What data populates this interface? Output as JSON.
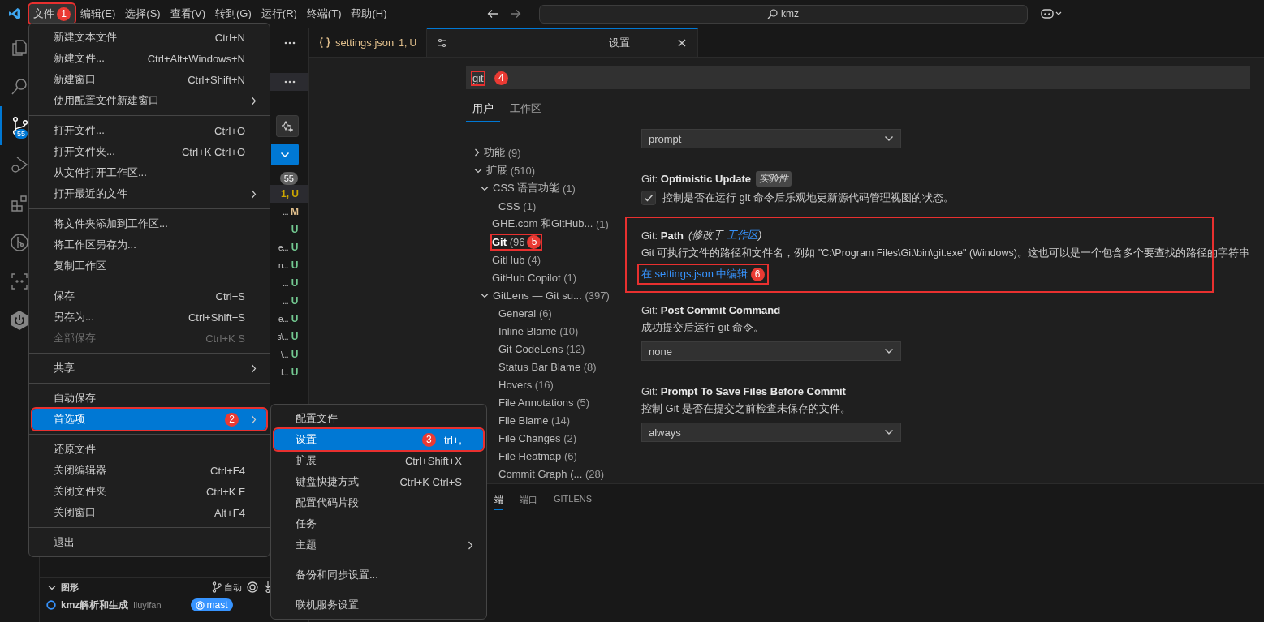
{
  "menubar": [
    {
      "label": "文件",
      "selected": true,
      "callout": "1"
    },
    {
      "label": "编辑(E)",
      "selected": false
    },
    {
      "label": "选择(S)",
      "selected": false
    },
    {
      "label": "查看(V)",
      "selected": false
    },
    {
      "label": "转到(G)",
      "selected": false
    },
    {
      "label": "运行(R)",
      "selected": false
    },
    {
      "label": "终端(T)",
      "selected": false
    },
    {
      "label": "帮助(H)",
      "selected": false
    }
  ],
  "command_center": {
    "value": "kmz"
  },
  "activity_bar": [
    {
      "kind": "files",
      "selected": false
    },
    {
      "kind": "search",
      "selected": false
    },
    {
      "kind": "scm",
      "selected": true,
      "badge": "55"
    },
    {
      "kind": "run",
      "selected": false
    },
    {
      "kind": "extensions",
      "selected": false
    },
    {
      "kind": "gitlens",
      "selected": false
    },
    {
      "kind": "remote",
      "selected": false
    },
    {
      "kind": "power",
      "selected": false
    }
  ],
  "source_control": {
    "changes_count": "55",
    "rows": [
      {
        "fragment": "-",
        "status": "1, U",
        "color": "#cca700",
        "selected": true
      },
      {
        "fragment": "...",
        "status": "M",
        "color": "#e2c08d",
        "selected": false
      },
      {
        "status": "U",
        "color": "#73c991",
        "selected": false
      },
      {
        "fragment": "e...",
        "status": "U",
        "color": "#73c991",
        "selected": false
      },
      {
        "fragment": "n...",
        "status": "U",
        "color": "#73c991",
        "selected": false
      },
      {
        "fragment": "...",
        "status": "U",
        "color": "#73c991",
        "selected": false
      },
      {
        "fragment": "...",
        "status": "U",
        "color": "#73c991",
        "selected": false
      },
      {
        "fragment": "e...",
        "status": "U",
        "color": "#73c991",
        "selected": false
      },
      {
        "fragment": "s\\...",
        "status": "U",
        "color": "#73c991",
        "selected": false
      },
      {
        "fragment": "\\...",
        "status": "U",
        "color": "#73c991",
        "selected": false
      },
      {
        "fragment": "f...",
        "status": "U",
        "color": "#73c991",
        "selected": false
      }
    ]
  },
  "graph": {
    "title": "图形",
    "mode": "自动",
    "commit": {
      "message": "kmz解析和生成",
      "author": "liuyifan",
      "branch": "mast"
    }
  },
  "editor_tabs": [
    {
      "kind": "json",
      "label": "settings.json",
      "badge": "1, U",
      "selected": false
    },
    {
      "kind": "settings",
      "label": "设置",
      "selected": true
    }
  ],
  "settings": {
    "search": {
      "value": "git",
      "callout": "4"
    },
    "scopes": [
      {
        "label": "用户",
        "selected": true
      },
      {
        "label": "工作区",
        "selected": false
      }
    ],
    "tree": [
      {
        "label": "功能",
        "count": "(9)",
        "expanded": false,
        "selected": false
      },
      {
        "label": "扩展",
        "count": "(510)",
        "expanded": true,
        "selected": false,
        "children": [
          {
            "label": "CSS 语言功能",
            "count": "(1)",
            "expanded": true,
            "selected": false,
            "children": [
              {
                "label": "CSS",
                "count": "(1)",
                "selected": false
              }
            ]
          },
          {
            "label": "GHE.com 和GitHub...",
            "count": "(1)",
            "selected": false
          },
          {
            "label": "Git",
            "count": "(96",
            "selected": true,
            "callout": "5"
          },
          {
            "label": "GitHub",
            "count": "(4)",
            "selected": false
          },
          {
            "label": "GitHub Copilot",
            "count": "(1)",
            "selected": false
          },
          {
            "label": "GitLens — Git su...",
            "count": "(397)",
            "expanded": true,
            "selected": false,
            "children": [
              {
                "label": "General",
                "count": "(6)",
                "selected": false
              },
              {
                "label": "Inline Blame",
                "count": "(10)",
                "selected": false
              },
              {
                "label": "Git CodeLens",
                "count": "(12)",
                "selected": false
              },
              {
                "label": "Status Bar Blame",
                "count": "(8)",
                "selected": false
              },
              {
                "label": "Hovers",
                "count": "(16)",
                "selected": false
              },
              {
                "label": "File Annotations",
                "count": "(5)",
                "selected": false
              },
              {
                "label": "File Blame",
                "count": "(14)",
                "selected": false
              },
              {
                "label": "File Changes",
                "count": "(2)",
                "selected": false
              },
              {
                "label": "File Heatmap",
                "count": "(6)",
                "selected": false
              },
              {
                "label": "Commit Graph (...",
                "count": "(28)",
                "selected": false
              }
            ]
          }
        ]
      }
    ],
    "items": [
      {
        "kind": "dropdown",
        "value": "prompt",
        "framed": false
      },
      {
        "kind": "checkbox",
        "category": "Git:",
        "name": "Optimistic Update",
        "tag": "实验性",
        "checked": true,
        "description": "控制是否在运行 git 命令后乐观地更新源代码管理视图的状态。",
        "framed": false
      },
      {
        "kind": "text",
        "category": "Git:",
        "name": "Path",
        "modified": {
          "prefix": "(修改于",
          "link": "工作区",
          "suffix": ")"
        },
        "description": "Git 可执行文件的路径和文件名，例如 \"C:\\Program Files\\Git\\bin\\git.exe\" (Windows)。这也可以是一个包含多个要查找的路径的字符串",
        "link": {
          "label": "在 settings.json 中编辑",
          "callout": "6"
        },
        "framed": true
      },
      {
        "kind": "dropdown",
        "category": "Git:",
        "name": "Post Commit Command",
        "description": "成功提交后运行 git 命令。",
        "value": "none",
        "framed": false
      },
      {
        "kind": "dropdown",
        "category": "Git:",
        "name": "Prompt To Save Files Before Commit",
        "description": "控制 Git 是否在提交之前检查未保存的文件。",
        "value": "always",
        "framed": false
      }
    ]
  },
  "panel_tabs": [
    {
      "label": "端",
      "selected": true
    },
    {
      "label": "端口",
      "selected": false
    },
    {
      "label": "GITLENS",
      "selected": false
    }
  ],
  "file_menu": [
    {
      "kind": "item",
      "label": "新建文本文件",
      "shortcut": "Ctrl+N",
      "submenu": false,
      "disabled": false,
      "selected": false
    },
    {
      "kind": "item",
      "label": "新建文件...",
      "shortcut": "Ctrl+Alt+Windows+N",
      "submenu": false,
      "disabled": false,
      "selected": false
    },
    {
      "kind": "item",
      "label": "新建窗口",
      "shortcut": "Ctrl+Shift+N",
      "submenu": false,
      "disabled": false,
      "selected": false
    },
    {
      "kind": "item",
      "label": "使用配置文件新建窗口",
      "submenu": true,
      "disabled": false,
      "selected": false
    },
    {
      "kind": "separator"
    },
    {
      "kind": "item",
      "label": "打开文件...",
      "shortcut": "Ctrl+O",
      "submenu": false,
      "disabled": false,
      "selected": false
    },
    {
      "kind": "item",
      "label": "打开文件夹...",
      "shortcut": "Ctrl+K Ctrl+O",
      "submenu": false,
      "disabled": false,
      "selected": false
    },
    {
      "kind": "item",
      "label": "从文件打开工作区...",
      "submenu": false,
      "disabled": false,
      "selected": false
    },
    {
      "kind": "item",
      "label": "打开最近的文件",
      "submenu": true,
      "disabled": false,
      "selected": false
    },
    {
      "kind": "separator"
    },
    {
      "kind": "item",
      "label": "将文件夹添加到工作区...",
      "submenu": false,
      "disabled": false,
      "selected": false
    },
    {
      "kind": "item",
      "label": "将工作区另存为...",
      "submenu": false,
      "disabled": false,
      "selected": false
    },
    {
      "kind": "item",
      "label": "复制工作区",
      "submenu": false,
      "disabled": false,
      "selected": false
    },
    {
      "kind": "separator"
    },
    {
      "kind": "item",
      "label": "保存",
      "shortcut": "Ctrl+S",
      "submenu": false,
      "disabled": false,
      "selected": false
    },
    {
      "kind": "item",
      "label": "另存为...",
      "shortcut": "Ctrl+Shift+S",
      "submenu": false,
      "disabled": false,
      "selected": false
    },
    {
      "kind": "item",
      "label": "全部保存",
      "shortcut": "Ctrl+K S",
      "submenu": false,
      "disabled": true,
      "selected": false
    },
    {
      "kind": "separator"
    },
    {
      "kind": "item",
      "label": "共享",
      "submenu": true,
      "disabled": false,
      "selected": false
    },
    {
      "kind": "separator"
    },
    {
      "kind": "item",
      "label": "自动保存",
      "submenu": false,
      "disabled": false,
      "selected": false
    },
    {
      "kind": "item",
      "label": "首选项",
      "submenu": true,
      "disabled": false,
      "selected": true,
      "callout": "2"
    },
    {
      "kind": "separator"
    },
    {
      "kind": "item",
      "label": "还原文件",
      "submenu": false,
      "disabled": false,
      "selected": false
    },
    {
      "kind": "item",
      "label": "关闭编辑器",
      "shortcut": "Ctrl+F4",
      "submenu": false,
      "disabled": false,
      "selected": false
    },
    {
      "kind": "item",
      "label": "关闭文件夹",
      "shortcut": "Ctrl+K F",
      "submenu": false,
      "disabled": false,
      "selected": false
    },
    {
      "kind": "item",
      "label": "关闭窗口",
      "shortcut": "Alt+F4",
      "submenu": false,
      "disabled": false,
      "selected": false
    },
    {
      "kind": "separator"
    },
    {
      "kind": "item",
      "label": "退出",
      "submenu": false,
      "disabled": false,
      "selected": false
    }
  ],
  "preferences_menu": [
    {
      "kind": "item",
      "label": "配置文件",
      "submenu": false,
      "disabled": false,
      "selected": false
    },
    {
      "kind": "item",
      "label": "设置",
      "shortcut": "trl+,",
      "submenu": false,
      "disabled": false,
      "selected": true,
      "callout": "3"
    },
    {
      "kind": "item",
      "label": "扩展",
      "shortcut": "Ctrl+Shift+X",
      "submenu": false,
      "disabled": false,
      "selected": false
    },
    {
      "kind": "item",
      "label": "键盘快捷方式",
      "shortcut": "Ctrl+K Ctrl+S",
      "submenu": false,
      "disabled": false,
      "selected": false
    },
    {
      "kind": "item",
      "label": "配置代码片段",
      "submenu": false,
      "disabled": false,
      "selected": false
    },
    {
      "kind": "item",
      "label": "任务",
      "submenu": false,
      "disabled": false,
      "selected": false
    },
    {
      "kind": "item",
      "label": "主题",
      "submenu": true,
      "disabled": false,
      "selected": false
    },
    {
      "kind": "separator"
    },
    {
      "kind": "item",
      "label": "备份和同步设置...",
      "submenu": false,
      "disabled": false,
      "selected": false
    },
    {
      "kind": "separator"
    },
    {
      "kind": "item",
      "label": "联机服务设置",
      "submenu": false,
      "disabled": false,
      "selected": false
    }
  ]
}
